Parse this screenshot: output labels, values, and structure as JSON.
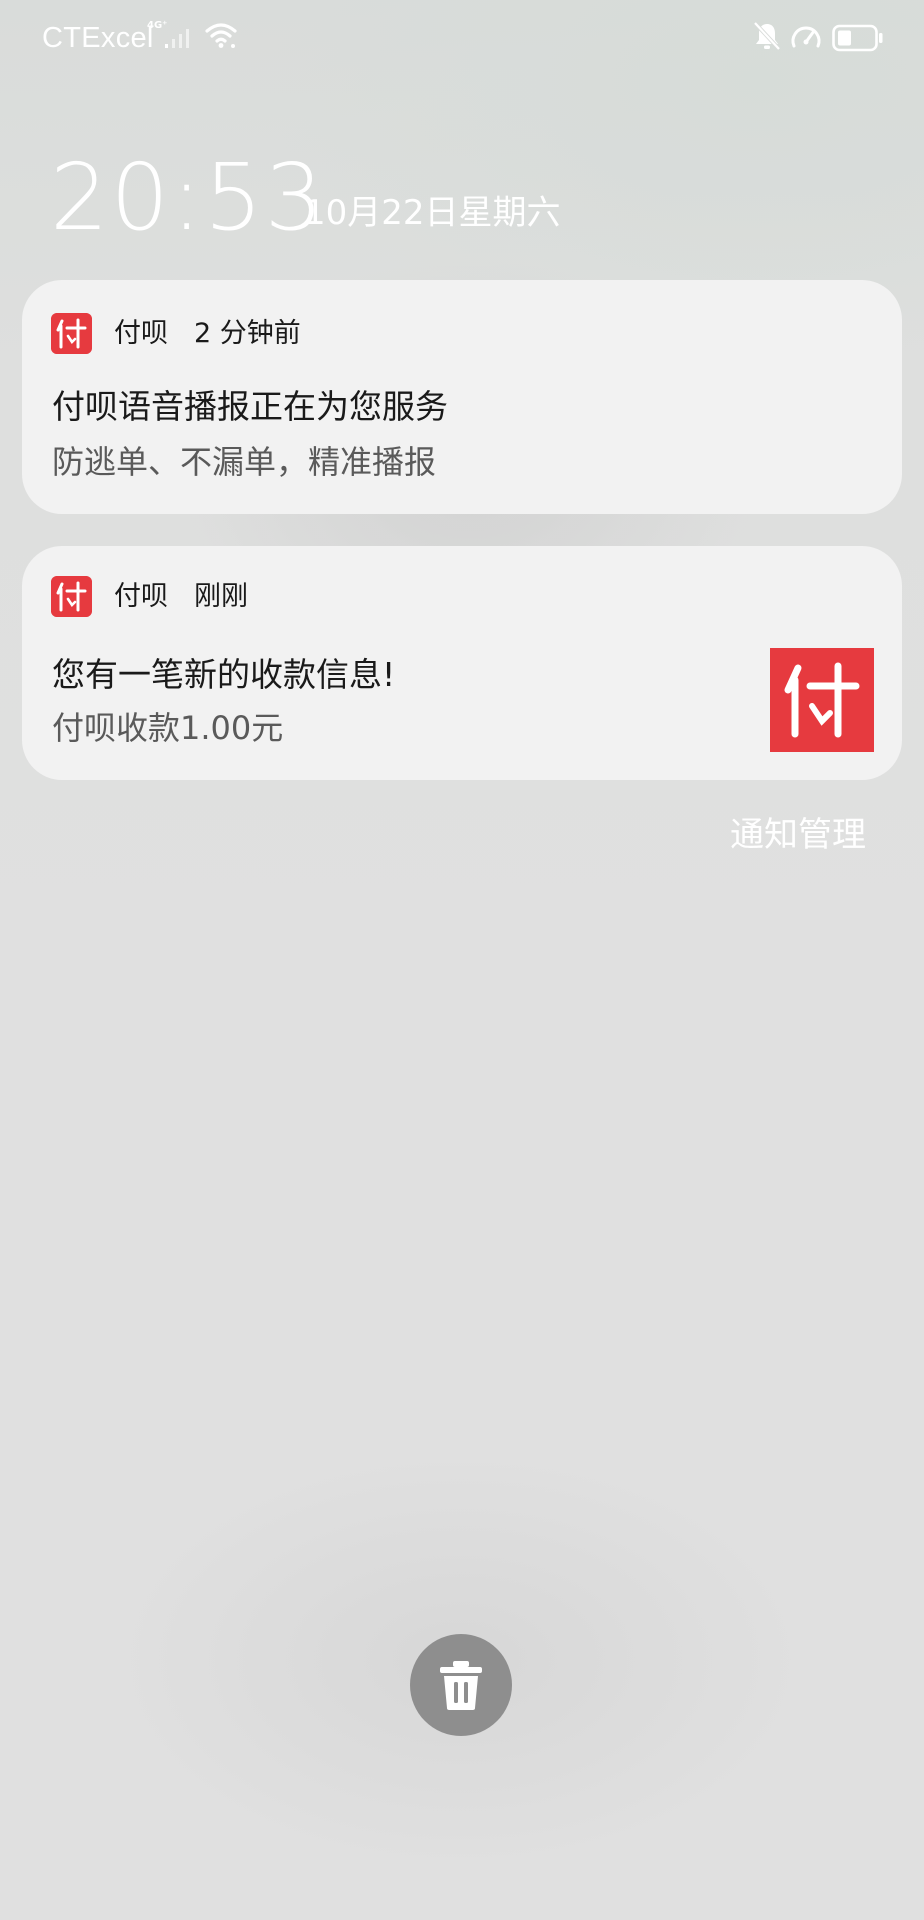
{
  "status_bar": {
    "carrier": "CTExcel",
    "network_type": "4G⁺",
    "icons": [
      "signal-icon",
      "wifi-icon",
      "bell-off-icon",
      "speed-icon",
      "battery-icon"
    ],
    "battery_level": 0.35
  },
  "lockscreen": {
    "time": "20:53",
    "date": "10月22日星期六"
  },
  "notifications": [
    {
      "app_name": "付呗",
      "timestamp": "2 分钟前",
      "title": "付呗语音播报正在为您服务",
      "body": "防逃单、不漏单，精准播报",
      "icon": "app-icon-fubei",
      "has_thumbnail": false
    },
    {
      "app_name": "付呗",
      "timestamp": "刚刚",
      "title": "您有一笔新的收款信息!",
      "body": "付呗收款1.00元",
      "icon": "app-icon-fubei",
      "has_thumbnail": true
    }
  ],
  "actions": {
    "manage_label": "通知管理",
    "clear_icon": "trash-icon"
  },
  "colors": {
    "brand_red": "#e63a3f",
    "card_bg": "#f3f3f3",
    "clear_button": "#8e8e8e"
  }
}
